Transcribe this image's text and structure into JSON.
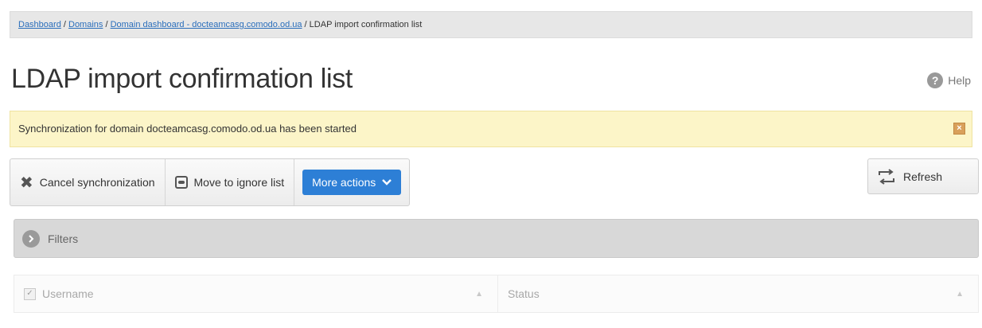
{
  "breadcrumb": {
    "items": [
      "Dashboard",
      "Domains",
      "Domain dashboard - docteamcasg.comodo.od.ua"
    ],
    "separator": " / ",
    "current": "LDAP import confirmation list"
  },
  "page": {
    "title": "LDAP import confirmation list",
    "help_label": "Help",
    "help_icon": "?"
  },
  "notice": {
    "text": "Synchronization for domain docteamcasg.comodo.od.ua has been started",
    "close_icon": "×"
  },
  "toolbar": {
    "cancel_icon": "✖",
    "cancel_label": "Cancel synchronization",
    "ignore_label": "Move to ignore list",
    "more_label": "More actions",
    "refresh_label": "Refresh"
  },
  "filters": {
    "label": "Filters"
  },
  "table": {
    "columns": [
      "Username",
      "Status"
    ],
    "sort_icon": "▲",
    "check_mark": "✓"
  },
  "colors": {
    "accent": "#2d7fd6",
    "notice_bg": "#fcf5c8",
    "link": "#2a6ebb"
  }
}
